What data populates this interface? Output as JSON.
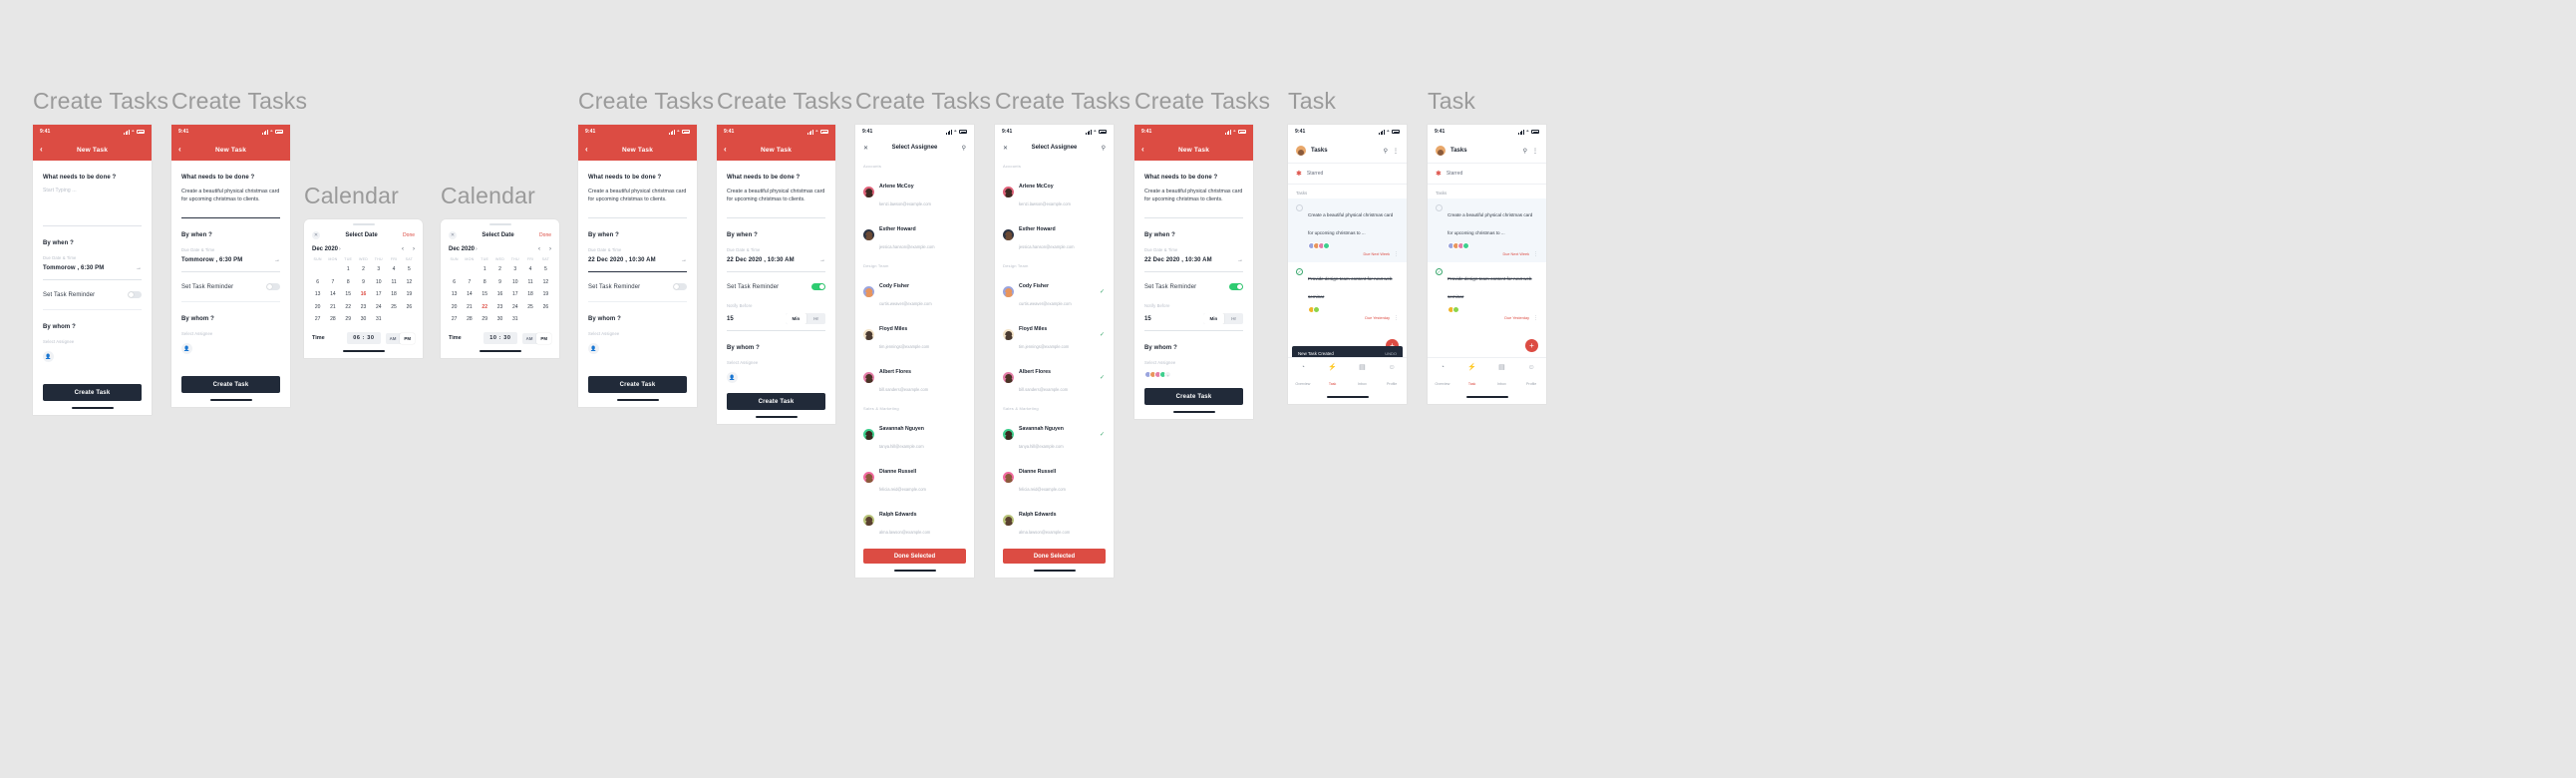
{
  "frames": [
    {
      "id": "f1",
      "title": "Create Tasks"
    },
    {
      "id": "f2",
      "title": "Create Tasks"
    },
    {
      "id": "f3",
      "title": "Calendar"
    },
    {
      "id": "f4",
      "title": "Calendar"
    },
    {
      "id": "f5",
      "title": "Create Tasks"
    },
    {
      "id": "f6",
      "title": "Create Tasks"
    },
    {
      "id": "f7",
      "title": "Create Tasks"
    },
    {
      "id": "f8",
      "title": "Create Tasks"
    },
    {
      "id": "f9",
      "title": "Create Tasks"
    },
    {
      "id": "f10",
      "title": "Task"
    },
    {
      "id": "f11",
      "title": "Task"
    }
  ],
  "status_bar": {
    "time": "9:41"
  },
  "nav": {
    "back_icon": "chevron-left-icon",
    "title": "New Task"
  },
  "form": {
    "q_what": "What needs to be done ?",
    "placeholder_task": "Start Typing ...",
    "task_value": "Create a beautiful physical christmas card for upcoming christmas to clients.",
    "q_when": "By when ?",
    "sub_when": "Due Date & Time",
    "due_default": "Tommorow , 6:30 PM",
    "due_set": "22 Dec 2020 , 10:30 AM",
    "reminder_label": "Set Task Reminder",
    "notify_label": "Notify Before",
    "notify_value": "15",
    "seg_min": "Min",
    "seg_hr": "Hr",
    "q_whom": "By whom ?",
    "sub_whom": "Select Assignee",
    "add_assignee_icon": "add-person-icon",
    "cta": "Create Task"
  },
  "calendar": {
    "close_icon": "close-icon",
    "title": "Select Date",
    "done": "Done",
    "month": "Dec 2020",
    "month_chevron": "chevron-right-icon",
    "prev_icon": "chevron-left-icon",
    "next_icon": "chevron-right-icon",
    "dow": [
      "SUN",
      "MON",
      "TUE",
      "WED",
      "THU",
      "FRI",
      "SAT"
    ],
    "lead_blanks": 2,
    "days": [
      1,
      2,
      3,
      4,
      5,
      6,
      7,
      8,
      9,
      10,
      11,
      12,
      13,
      14,
      15,
      16,
      17,
      18,
      19,
      20,
      21,
      22,
      23,
      24,
      25,
      26,
      27,
      28,
      29,
      30,
      31
    ],
    "selected_a": 16,
    "selected_b": 22,
    "time_label": "Time",
    "time_a": "06 : 30",
    "time_b": "10 : 30",
    "am": "AM",
    "pm": "PM",
    "active_a": "PM",
    "active_b": "PM"
  },
  "assignee": {
    "close_icon": "close-icon",
    "title": "Select Assignee",
    "search_icon": "search-icon",
    "cta": "Done Selected",
    "groups": [
      {
        "label": "Accounts",
        "people": [
          {
            "name": "Arlene McCoy",
            "email": "kenzi.lawson@example.com",
            "av1": "#e0627a",
            "av2": "#3d2a22",
            "selected": false
          },
          {
            "name": "Esther Howard",
            "email": "jessica.hanson@example.com",
            "av1": "#2b3342",
            "av2": "#6b4a35",
            "selected": false
          }
        ]
      },
      {
        "label": "Design Team",
        "people": [
          {
            "name": "Cody Fisher",
            "email": "curtis.weaver@example.com",
            "av1": "#9aa4dd",
            "av2": "#e8955c",
            "selected": true
          },
          {
            "name": "Floyd Miles",
            "email": "tim.jennings@example.com",
            "av1": "#f3e3c8",
            "av2": "#4a3a30",
            "selected": true
          },
          {
            "name": "Albert Flores",
            "email": "bill.sanders@example.com",
            "av1": "#e47ea8",
            "av2": "#4a3326",
            "selected": true
          }
        ]
      },
      {
        "label": "Sales & Marketing",
        "people": [
          {
            "name": "Savannah Nguyen",
            "email": "tanya.hill@example.com",
            "av1": "#3ecf8e",
            "av2": "#3a2a20",
            "selected": true
          },
          {
            "name": "Dianne Russell",
            "email": "felicia.reid@example.com",
            "av1": "#f26ba0",
            "av2": "#8a5a3b",
            "selected": false
          },
          {
            "name": "Ralph Edwards",
            "email": "alma.lawson@example.com",
            "av1": "#b9c47a",
            "av2": "#5a4030",
            "selected": false
          }
        ]
      }
    ]
  },
  "tasklist": {
    "title": "Tasks",
    "search_icon": "search-icon",
    "menu_icon": "more-vertical-icon",
    "starred_icon": "star-icon",
    "starred_label": "Starred",
    "section_label": "Tasks",
    "items": [
      {
        "text": "Create a beautiful physical christmas card for upcoming christmas to ...",
        "due": "Due Next Week",
        "done": false,
        "highlight": true,
        "faces": [
          "#9aa4dd",
          "#e8955c",
          "#e47ea8",
          "#3ecf8e"
        ]
      },
      {
        "text": "Provide design team content for next web seminar",
        "due": "Due Yesterday",
        "done": true,
        "highlight": false,
        "faces": [
          "#f0b429",
          "#8bd44a"
        ]
      }
    ],
    "fab_icon": "plus-icon",
    "toast": {
      "message": "New Task Created",
      "action": "UNDO"
    },
    "tabs": [
      {
        "label": "Overview",
        "icon": "pie-chart-icon",
        "active": false
      },
      {
        "label": "Task",
        "icon": "bolt-icon",
        "active": true
      },
      {
        "label": "Inbox",
        "icon": "inbox-icon",
        "active": false
      },
      {
        "label": "Profile",
        "icon": "person-icon",
        "active": false
      }
    ]
  },
  "colors": {
    "brand_red": "#dc4c43",
    "dark": "#212a39",
    "green": "#2ecc71"
  }
}
